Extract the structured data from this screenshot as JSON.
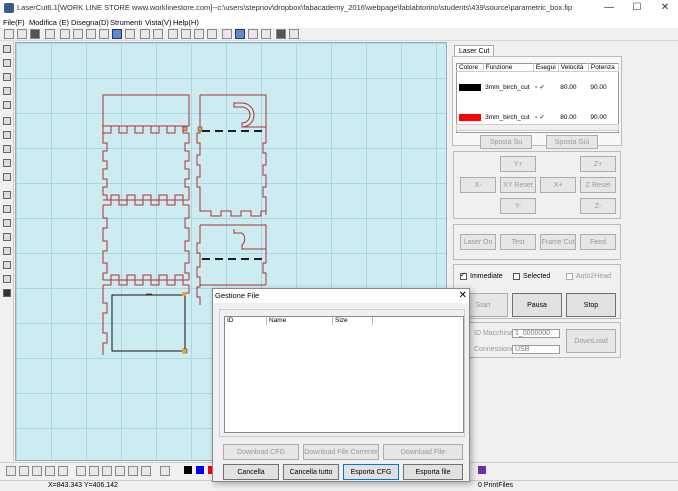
{
  "window": {
    "title": "LaserCut6.1[WORK LINE STORE www.worklinestore.com]--c:\\users\\stepnov\\dropbox\\fabacademy_2016\\webpage\\fablabtorino\\students\\439\\source\\parametric_box.fip",
    "minimize": "—",
    "maximize": "☐",
    "close": "✕"
  },
  "menu": [
    "File(F)",
    "Modifica (E)",
    "Disegna(D)",
    "Strumenti",
    "Vista(V)",
    "Help(H)"
  ],
  "right_panel": {
    "tab_label": "Laser Cut",
    "layers": {
      "headers": [
        "Colore",
        "Funzione",
        "Esegui",
        "Velocità",
        "Potenza"
      ],
      "rows": [
        {
          "color": "#000000",
          "function": "3mm_birch_cut",
          "speed": "80.00",
          "power": "90.00"
        },
        {
          "color": "#ff0000",
          "function": "3mm_birch_cut",
          "speed": "80.00",
          "power": "90.00"
        }
      ]
    },
    "sposta_su": "Sposta Su",
    "sposta_giu": "Sposta Giù",
    "jog": {
      "y_plus": "Y+",
      "z_plus": "Z+",
      "x_minus": "X-",
      "xy_reset": "XY Reset",
      "x_plus": "X+",
      "z_reset": "Z Reset",
      "y_minus": "Y-",
      "z_minus": "Z-"
    },
    "laser_on": "Laser On",
    "test": "Test",
    "frame_cut": "Frame Cut",
    "feed": "Feed",
    "immediate": "Immediate",
    "selected": "Selected",
    "autoshead": "Auto2Head",
    "start": "Start",
    "pausa": "Pausa",
    "stop": "Stop",
    "id_macchina_label": "ID Macchina",
    "id_macchina_value": "1_0000000",
    "connessione_label": "Connessione",
    "connessione_value": "USB",
    "download": "DownLoad"
  },
  "dialog": {
    "title": "Gestione File",
    "close": "✕",
    "columns": [
      "ID",
      "Name",
      "Size"
    ],
    "download_cfg": "Download CFG",
    "download_file_corrente": "Download File Corrente",
    "download_file": "Download File",
    "cancella": "Cancella",
    "cancella_tutto": "Cancella tutto",
    "esporta_cfg": "Esporta CFG",
    "esporta_file": "Esporta file"
  },
  "status": {
    "coords": "X=843.343 Y=406.142",
    "print_files": "0 PrintFiles"
  },
  "palette": [
    "#000000",
    "#0000ff",
    "#ff0000",
    "#7030a0"
  ]
}
